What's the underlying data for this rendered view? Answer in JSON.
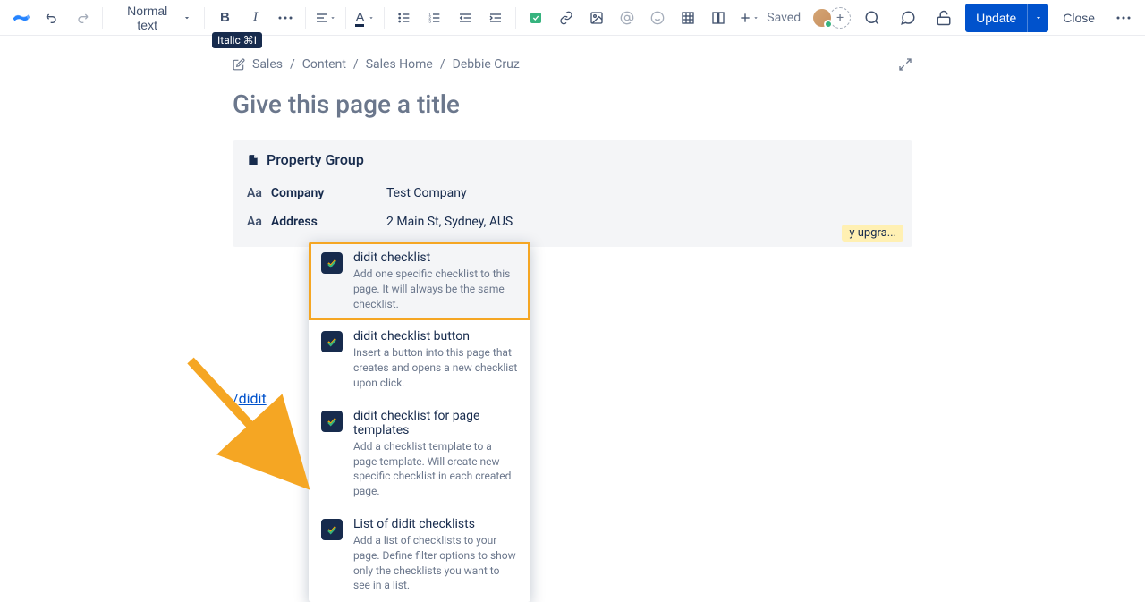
{
  "toolbar": {
    "text_style": "Normal text",
    "tooltip": "Italic ⌘I",
    "saved": "Saved",
    "update": "Update",
    "close": "Close"
  },
  "breadcrumb": [
    "Sales",
    "Content",
    "Sales Home",
    "Debbie Cruz"
  ],
  "page_title_placeholder": "Give this page a title",
  "property_group": {
    "title": "Property Group",
    "rows": [
      {
        "label": "Company",
        "value": "Test Company",
        "type_icon": "Aa"
      },
      {
        "label": "Address",
        "value": "2 Main St, Sydney, AUS",
        "type_icon": "Aa"
      }
    ],
    "feedback": "y upgra..."
  },
  "slash_text": {
    "slash": "/",
    "query": "didit"
  },
  "macro_menu": [
    {
      "title": "didit checklist",
      "desc": "Add one specific checklist to this page. It will always be the same checklist.",
      "active": true
    },
    {
      "title": "didit checklist button",
      "desc": "Insert a button into this page that creates and opens a new checklist upon click.",
      "active": false
    },
    {
      "title": "didit checklist for page templates",
      "desc": "Add a checklist template to a page template. Will create new specific checklist in each created page.",
      "active": false
    },
    {
      "title": "List of didit checklists",
      "desc": "Add a list of checklists to your page. Define filter options to show only the checklists you want to see in a list.",
      "active": false
    }
  ]
}
